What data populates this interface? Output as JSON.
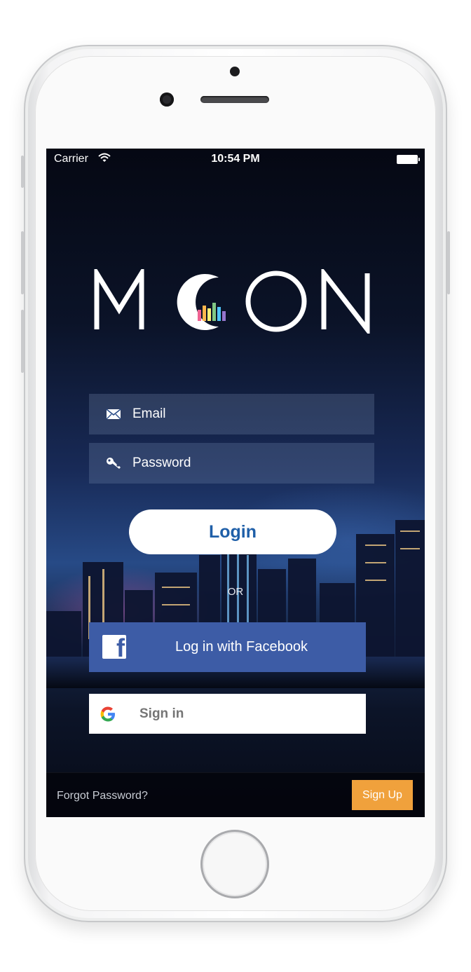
{
  "status_bar": {
    "carrier": "Carrier",
    "time": "10:54 PM"
  },
  "app": {
    "logo_text": "MOON"
  },
  "form": {
    "email_placeholder": "Email",
    "password_placeholder": "Password",
    "login_label": "Login",
    "or_label": "OR"
  },
  "social": {
    "facebook_label": "Log in with Facebook",
    "google_label": "Sign in"
  },
  "footer": {
    "forgot_label": "Forgot Password?",
    "signup_label": "Sign Up"
  },
  "colors": {
    "facebook": "#3d5ca6",
    "login_text": "#1f5fa8",
    "signup": "#f0a13c"
  },
  "icons": [
    "wifi-icon",
    "battery-icon",
    "email-icon",
    "key-icon",
    "facebook-icon",
    "google-icon"
  ]
}
